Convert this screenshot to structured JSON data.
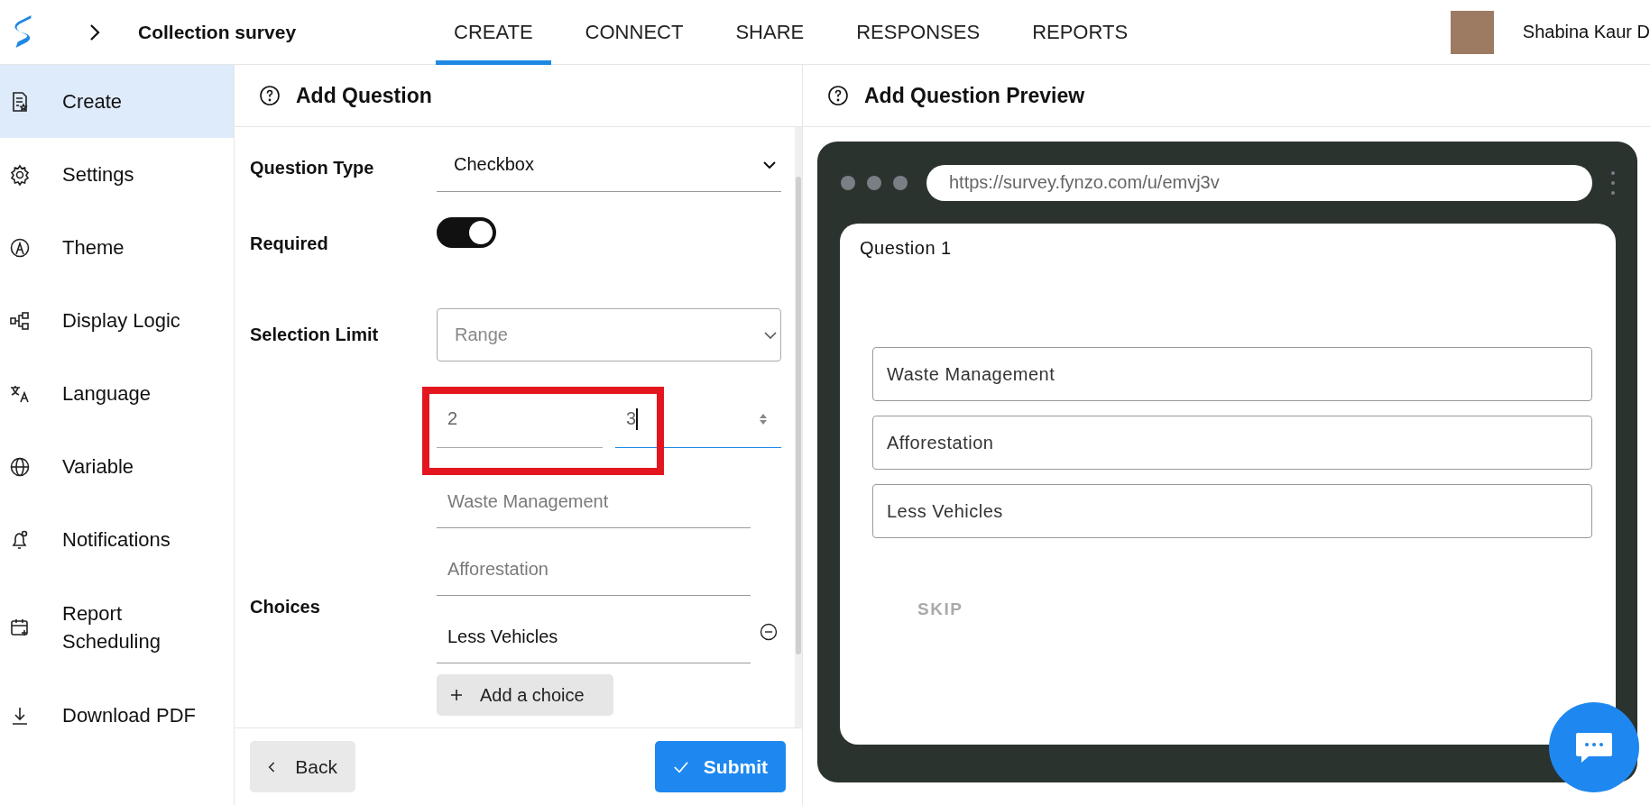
{
  "topbar": {
    "title": "Collection survey",
    "user_name": "Shabina Kaur D"
  },
  "tabs": [
    {
      "label": "CREATE",
      "selected": true
    },
    {
      "label": "CONNECT",
      "selected": false
    },
    {
      "label": "SHARE",
      "selected": false
    },
    {
      "label": "RESPONSES",
      "selected": false
    },
    {
      "label": "REPORTS",
      "selected": false
    }
  ],
  "sidebar": {
    "items": [
      {
        "label": "Create",
        "selected": true
      },
      {
        "label": "Settings",
        "selected": false
      },
      {
        "label": "Theme",
        "selected": false
      },
      {
        "label": "Display Logic",
        "selected": false
      },
      {
        "label": "Language",
        "selected": false
      },
      {
        "label": "Variable",
        "selected": false
      },
      {
        "label": "Notifications",
        "selected": false
      },
      {
        "label": "Report Scheduling",
        "selected": false
      },
      {
        "label": "Download PDF",
        "selected": false
      }
    ]
  },
  "editor": {
    "title": "Add Question",
    "question_type": {
      "label": "Question Type",
      "value": "Checkbox"
    },
    "required": {
      "label": "Required",
      "on": true
    },
    "selection_limit": {
      "label": "Selection Limit",
      "placeholder": "Range",
      "highlighted": true,
      "min": {
        "value": "2",
        "focused": false
      },
      "max": {
        "value": "3",
        "focused": true
      }
    },
    "choices_label": "Choices",
    "choices": [
      {
        "placeholder": "Waste Management",
        "removable": false
      },
      {
        "placeholder": "Afforestation",
        "removable": false
      },
      {
        "value": "Less Vehicles",
        "removable": true
      }
    ],
    "add_choice": "Add a choice",
    "back": "Back",
    "submit": "Submit"
  },
  "preview": {
    "title": "Add Question Preview",
    "url": "https://survey.fynzo.com/u/emvj3v",
    "question": "Question 1",
    "options": [
      "Waste Management",
      "Afforestation",
      "Less Vehicles"
    ],
    "skip": "SKIP"
  }
}
